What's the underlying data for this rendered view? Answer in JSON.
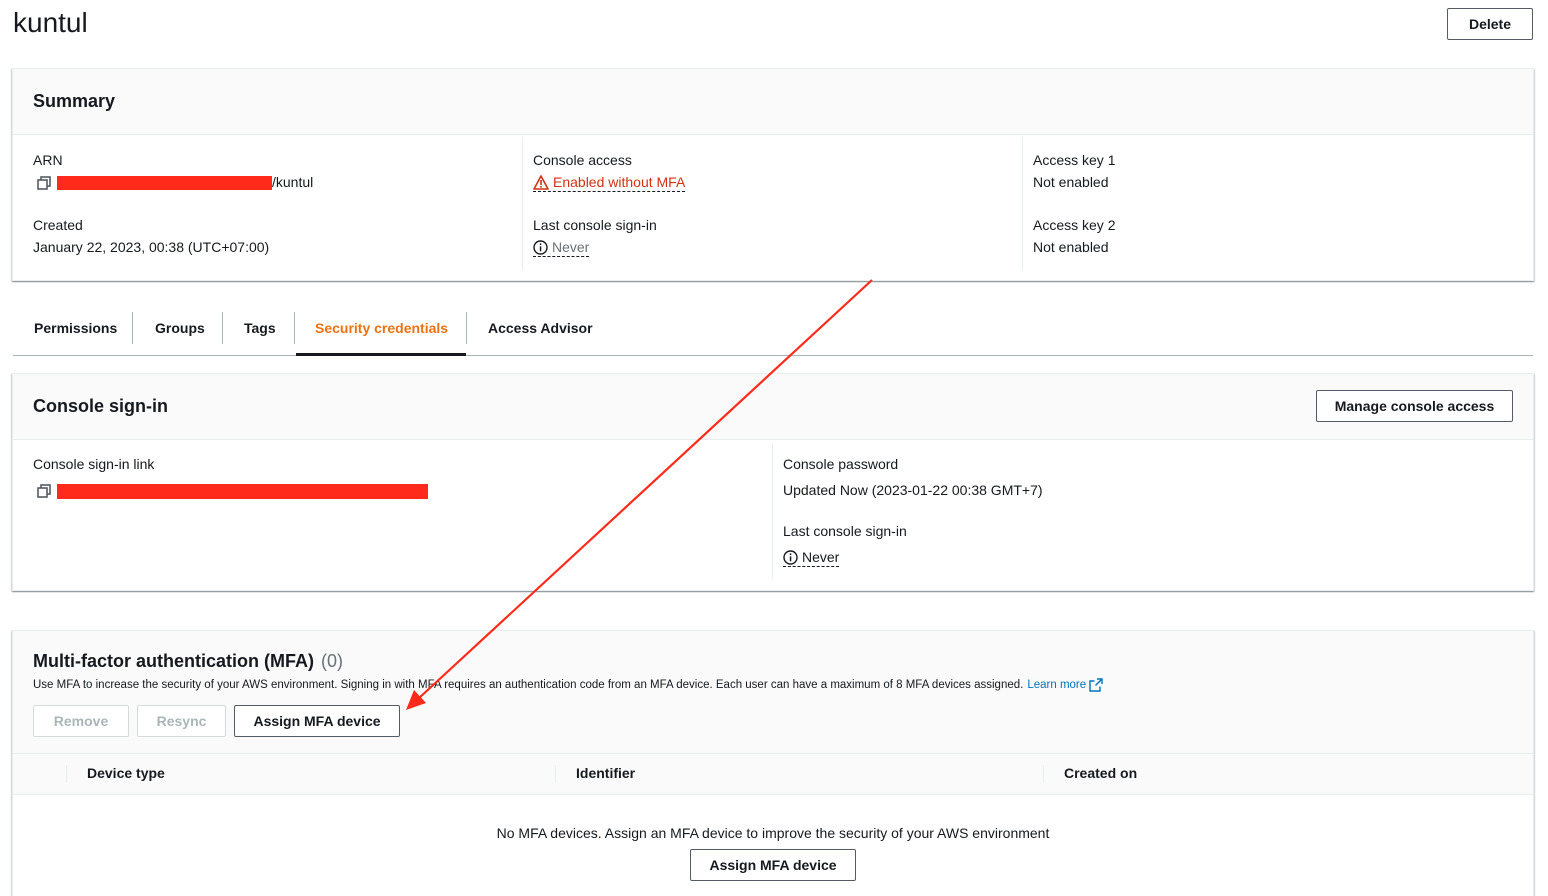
{
  "page": {
    "title": "kuntul",
    "delete_label": "Delete"
  },
  "summary": {
    "title": "Summary",
    "arn": {
      "label": "ARN",
      "suffix": "/kuntul"
    },
    "created": {
      "label": "Created",
      "value": "January 22, 2023, 00:38 (UTC+07:00)"
    },
    "console_access": {
      "label": "Console access",
      "value": "Enabled without MFA"
    },
    "last_signin": {
      "label": "Last console sign-in",
      "value": "Never"
    },
    "access_key_1": {
      "label": "Access key 1",
      "value": "Not enabled"
    },
    "access_key_2": {
      "label": "Access key 2",
      "value": "Not enabled"
    }
  },
  "tabs": [
    {
      "label": "Permissions"
    },
    {
      "label": "Groups"
    },
    {
      "label": "Tags"
    },
    {
      "label": "Security credentials"
    },
    {
      "label": "Access Advisor"
    }
  ],
  "active_tab": "Security credentials",
  "console_signin": {
    "title": "Console sign-in",
    "manage_label": "Manage console access",
    "link_label": "Console sign-in link",
    "password_label": "Console password",
    "password_value": "Updated Now (2023-01-22 00:38 GMT+7)",
    "last_signin_label": "Last console sign-in",
    "last_signin_value": "Never"
  },
  "mfa": {
    "title": "Multi-factor authentication (MFA)",
    "count": "(0)",
    "description": "Use MFA to increase the security of your AWS environment. Signing in with MFA requires an authentication code from an MFA device. Each user can have a maximum of 8 MFA devices assigned.",
    "learn_more": "Learn more",
    "remove_label": "Remove",
    "resync_label": "Resync",
    "assign_label": "Assign MFA device",
    "columns": [
      "Device type",
      "Identifier",
      "Created on"
    ],
    "empty_text": "No MFA devices. Assign an MFA device to improve the security of your AWS environment",
    "empty_assign_label": "Assign MFA device"
  },
  "colors": {
    "warning": "#d13212",
    "active_tab": "#ec7211",
    "link": "#0073bb",
    "annotation": "#ff2a1a"
  }
}
